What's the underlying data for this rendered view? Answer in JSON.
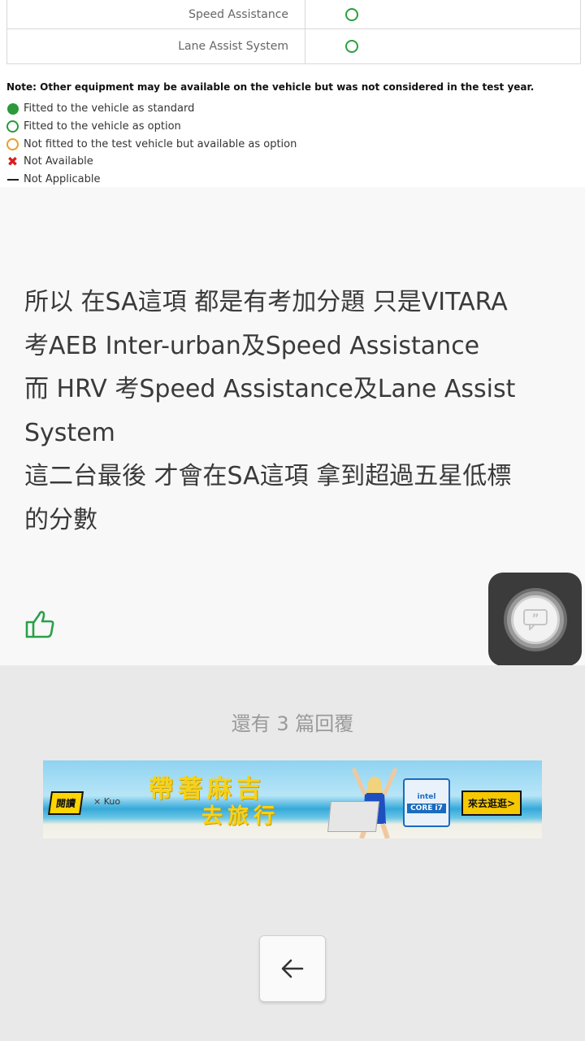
{
  "equipment_table": {
    "rows": [
      {
        "name": "Speed Assistance",
        "status": "fitted-as-option"
      },
      {
        "name": "Lane Assist System",
        "status": "fitted-as-option"
      }
    ],
    "note": "Note: Other equipment may be available on the vehicle but was not considered in the test year.",
    "legend": [
      {
        "label": "Fitted to the vehicle as standard",
        "icon": "filled-green-circle"
      },
      {
        "label": "Fitted to the vehicle as option",
        "icon": "green-ring"
      },
      {
        "label": "Not fitted to the test vehicle but available as option",
        "icon": "orange-ring"
      },
      {
        "label": "Not Available",
        "icon": "red-x"
      },
      {
        "label": "Not Applicable",
        "icon": "dash"
      }
    ],
    "colors": {
      "green": "#2a9a3a",
      "orange": "#e5a02a",
      "red": "#d42020"
    }
  },
  "post": {
    "lines": [
      "所以 在SA這項 都是有考加分題 只是VITARA",
      "考AEB Inter-urban及Speed Assistance",
      "而 HRV 考Speed Assistance及Lane Assist",
      "System",
      "這二台最後 才會在SA這項 拿到超過五星低標",
      "的分數"
    ]
  },
  "like_icon": "thumbs-up-icon",
  "float_button_icon": "quote-icon",
  "more_replies": "還有 3 篇回覆",
  "banner": {
    "logo": "閱讀",
    "logo2": "× Kuo",
    "slogan_line1": "帶著麻吉",
    "slogan_line2": "去旅行",
    "intel_brand": "intel",
    "intel_core": "CORE i7",
    "cta": "來去逛逛>"
  },
  "back_button_icon": "arrow-left-icon"
}
